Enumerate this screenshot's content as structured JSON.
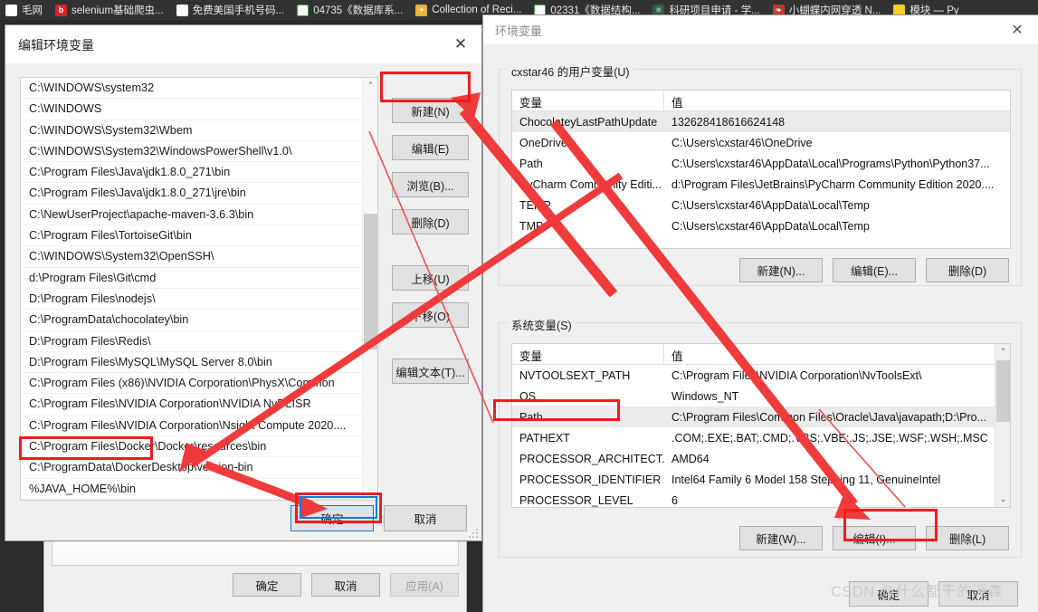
{
  "browser": {
    "tabs": [
      {
        "label": "毛网",
        "icon": "generic-favicon",
        "icon_class": "fv-360"
      },
      {
        "label": "selenium基础爬虫...",
        "icon": "baidu-favicon",
        "icon_class": "fv-bd",
        "glyph": "b"
      },
      {
        "label": "免费美国手机号码...",
        "icon": "360-favicon",
        "icon_class": "fv-360",
        "glyph": "◑"
      },
      {
        "label": "04735《数据库系...",
        "icon": "ie-favicon",
        "icon_class": "fv-ie",
        "glyph": "e"
      },
      {
        "label": "Collection of Reci...",
        "icon": "puzzle-favicon",
        "icon_class": "fv-puzzle",
        "glyph": "✦"
      },
      {
        "label": "02331《数据结构...",
        "icon": "ie-favicon",
        "icon_class": "fv-ie",
        "glyph": "e"
      },
      {
        "label": "科研项目申请 - 学...",
        "icon": "atom-favicon",
        "icon_class": "fv-atom",
        "glyph": "⚛"
      },
      {
        "label": "小蝴蝶内网穿透 N...",
        "icon": "butterfly-favicon",
        "icon_class": "fv-fire",
        "glyph": "❧"
      },
      {
        "label": "模块 — Py",
        "icon": "python-favicon",
        "icon_class": "fv-py",
        "glyph": ""
      }
    ]
  },
  "edit_dialog": {
    "title": "编辑环境变量",
    "close_label": "✕",
    "path_entries": [
      "C:\\WINDOWS\\system32",
      "C:\\WINDOWS",
      "C:\\WINDOWS\\System32\\Wbem",
      "C:\\WINDOWS\\System32\\WindowsPowerShell\\v1.0\\",
      "C:\\Program Files\\Java\\jdk1.8.0_271\\bin",
      "C:\\Program Files\\Java\\jdk1.8.0_271\\jre\\bin",
      "C:\\NewUserProject\\apache-maven-3.6.3\\bin",
      "C:\\Program Files\\TortoiseGit\\bin",
      "C:\\WINDOWS\\System32\\OpenSSH\\",
      "d:\\Program Files\\Git\\cmd",
      "D:\\Program Files\\nodejs\\",
      "C:\\ProgramData\\chocolatey\\bin",
      "D:\\Program Files\\Redis\\",
      "D:\\Program Files\\MySQL\\MySQL Server 8.0\\bin",
      "C:\\Program Files (x86)\\NVIDIA Corporation\\PhysX\\Common",
      "C:\\Program Files\\NVIDIA Corporation\\NVIDIA NvDLISR",
      "C:\\Program Files\\NVIDIA Corporation\\Nsight Compute 2020....",
      "C:\\Program Files\\Docker\\Docker\\resources\\bin",
      "C:\\ProgramData\\DockerDesktop\\version-bin",
      "%JAVA_HOME%\\bin"
    ],
    "side_buttons": [
      {
        "label": "新建(N)",
        "name": "new-button"
      },
      {
        "label": "编辑(E)",
        "name": "edit-button"
      },
      {
        "label": "浏览(B)...",
        "name": "browse-button"
      },
      {
        "label": "删除(D)",
        "name": "delete-button"
      },
      {
        "label": "上移(U)",
        "name": "move-up-button"
      },
      {
        "label": "下移(O)",
        "name": "move-down-button"
      },
      {
        "label": "编辑文本(T)...",
        "name": "edit-text-button"
      }
    ],
    "ok_label": "确定",
    "cancel_label": "取消",
    "scroll_up_glyph": "⌃",
    "scroll_down_glyph": "⌄"
  },
  "env_window": {
    "title": "环境变量",
    "close_label": "✕",
    "user_group_label": "cxstar46 的用户变量(U)",
    "system_group_label": "系统变量(S)",
    "columns": {
      "variable": "变量",
      "value": "值"
    },
    "user_variables": [
      {
        "name": "ChocolateyLastPathUpdate",
        "value": "132628418616624148",
        "selected": true
      },
      {
        "name": "OneDrive",
        "value": "C:\\Users\\cxstar46\\OneDrive",
        "selected": false
      },
      {
        "name": "Path",
        "value": "C:\\Users\\cxstar46\\AppData\\Local\\Programs\\Python\\Python37...",
        "selected": false
      },
      {
        "name": "PyCharm Community Editi...",
        "value": "d:\\Program Files\\JetBrains\\PyCharm Community Edition 2020....",
        "selected": false
      },
      {
        "name": "TEMP",
        "value": "C:\\Users\\cxstar46\\AppData\\Local\\Temp",
        "selected": false
      },
      {
        "name": "TMP",
        "value": "C:\\Users\\cxstar46\\AppData\\Local\\Temp",
        "selected": false
      }
    ],
    "user_buttons": [
      {
        "label": "新建(N)...",
        "name": "user-new-button"
      },
      {
        "label": "编辑(E)...",
        "name": "user-edit-button"
      },
      {
        "label": "删除(D)",
        "name": "user-delete-button"
      }
    ],
    "system_variables": [
      {
        "name": "NVTOOLSEXT_PATH",
        "value": "C:\\Program Files\\NVIDIA Corporation\\NvToolsExt\\",
        "selected": false
      },
      {
        "name": "OS",
        "value": "Windows_NT",
        "selected": false
      },
      {
        "name": "Path",
        "value": "C:\\Program Files\\Common Files\\Oracle\\Java\\javapath;D:\\Pro...",
        "selected": true
      },
      {
        "name": "PATHEXT",
        "value": ".COM;.EXE;.BAT;.CMD;.VBS;.VBE;.JS;.JSE;.WSF;.WSH;.MSC",
        "selected": false
      },
      {
        "name": "PROCESSOR_ARCHITECT...",
        "value": "AMD64",
        "selected": false
      },
      {
        "name": "PROCESSOR_IDENTIFIER",
        "value": "Intel64 Family 6 Model 158 Stepping 11, GenuineIntel",
        "selected": false
      },
      {
        "name": "PROCESSOR_LEVEL",
        "value": "6",
        "selected": false
      }
    ],
    "system_buttons": [
      {
        "label": "新建(W)...",
        "name": "system-new-button"
      },
      {
        "label": "编辑(I)...",
        "name": "system-edit-button"
      },
      {
        "label": "删除(L)",
        "name": "system-delete-button"
      }
    ],
    "ok_label": "确定",
    "cancel_label": "取消"
  },
  "background_window": {
    "ok_label": "确定",
    "cancel_label": "取消",
    "apply_label": "应用(A)"
  },
  "annotations": {
    "highlight_color": "#f01c1c",
    "focus_color": "#0a7bd4",
    "arrow_color": "#ef3b3b"
  },
  "watermark": "CSDN @什么都干的派森"
}
